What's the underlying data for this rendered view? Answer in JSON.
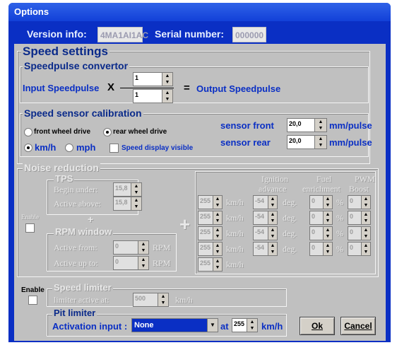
{
  "window": {
    "title": "Options"
  },
  "header": {
    "version_label": "Version info:",
    "version_value": "4MA1AI1AC",
    "serial_label": "Serial number:",
    "serial_value": "000000"
  },
  "speed_settings": {
    "title": "Speed settings",
    "convertor": {
      "title": "Speedpulse convertor",
      "input_label": "Input Speedpulse",
      "times": "X",
      "numerator": "1",
      "denominator": "1",
      "equals": "=",
      "output_label": "Output Speedpulse"
    },
    "calibration": {
      "title": "Speed sensor calibration",
      "front_wheel_drive": "front wheel drive",
      "rear_wheel_drive": "rear wheel drive",
      "kmh": "km/h",
      "mph": "mph",
      "display_visible": "Speed display visible",
      "sensor_front_label": "sensor front",
      "sensor_front_value": "20,0",
      "sensor_rear_label": "sensor rear",
      "sensor_rear_value": "20,0",
      "unit": "mm/pulse"
    }
  },
  "noise": {
    "title": "Noise reduction",
    "enable": "Enable",
    "tps_title": "TPS",
    "begin_under_label": "Begin under:",
    "begin_under_value": "15,8",
    "active_above_label": "Active above:",
    "active_above_value": "15,8",
    "rpm_title": "RPM window",
    "active_from_label": "Active from:",
    "active_from_value": "0",
    "active_upto_label": "Active up to:",
    "active_upto_value": "0",
    "rpm_unit": "RPM",
    "plus": "+",
    "col_ignition_1": "Ignition",
    "col_ignition_2": "advance",
    "col_fuel_1": "Fuel",
    "col_fuel_2": "enrichment",
    "col_pwm_1": "PWM",
    "col_pwm_2": "Boost",
    "rows": [
      {
        "speed": "255",
        "unit": "km/h",
        "ign": "-54",
        "deg": "deg.",
        "fuel": "0",
        "pct": "%",
        "pwm": "0"
      },
      {
        "speed": "255",
        "unit": "km/h",
        "ign": "-54",
        "deg": "deg.",
        "fuel": "0",
        "pct": "%",
        "pwm": "0"
      },
      {
        "speed": "255",
        "unit": "km/h",
        "ign": "-54",
        "deg": "deg.",
        "fuel": "0",
        "pct": "%",
        "pwm": "0"
      },
      {
        "speed": "255",
        "unit": "km/h",
        "ign": "-54",
        "deg": "deg.",
        "fuel": "0",
        "pct": "%",
        "pwm": "0"
      },
      {
        "speed": "255",
        "unit": "km/h"
      }
    ]
  },
  "speed_limiter": {
    "enable": "Enable",
    "title": "Speed limiter",
    "label": "limiter active at:",
    "value": "500",
    "unit": "km/h"
  },
  "pit_limiter": {
    "title": "Pit limiter",
    "label": "Activation input :",
    "input_value": "None",
    "at": "at",
    "speed_value": "255",
    "unit": "km/h"
  },
  "buttons": {
    "ok": "Ok",
    "cancel": "Cancel"
  }
}
